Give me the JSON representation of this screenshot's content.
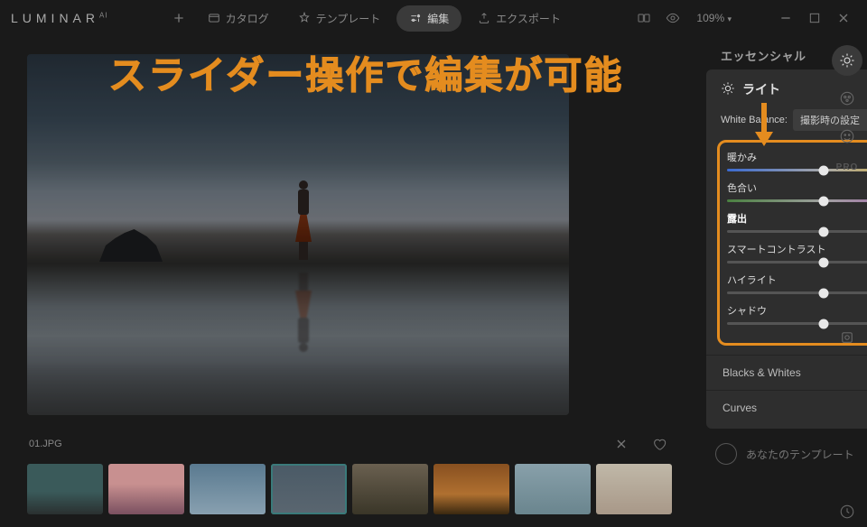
{
  "app": {
    "name": "LUMINAR",
    "suffix": "AI"
  },
  "topnav": {
    "add": "+",
    "catalog": "カタログ",
    "template": "テンプレート",
    "edit": "編集",
    "export": "エクスポート",
    "zoom": "109%"
  },
  "sectionTitle": "エッセンシャル",
  "panel": {
    "title": "ライト",
    "wbLabel": "White Balance:",
    "wbValue": "撮影時の設定",
    "sliders": [
      {
        "label": "暖かみ",
        "value": "0",
        "variant": "warmth",
        "bold": false
      },
      {
        "label": "色合い",
        "value": "0",
        "variant": "tint",
        "bold": false
      },
      {
        "label": "露出",
        "value": "0.00",
        "variant": "plain",
        "bold": true
      },
      {
        "label": "スマートコントラスト",
        "value": "0",
        "variant": "plain",
        "bold": false
      },
      {
        "label": "ハイライト",
        "value": "0",
        "variant": "plain",
        "bold": false
      },
      {
        "label": "シャドウ",
        "value": "0",
        "variant": "plain",
        "bold": false
      }
    ],
    "sub1": "Blacks & Whites",
    "sub2": "Curves"
  },
  "templates": {
    "label": "あなたのテンプレート"
  },
  "filmstrip": {
    "filename": "01.JPG"
  },
  "rail": {
    "pro": "PRO"
  },
  "annotation": "スライダー操作で編集が可能"
}
